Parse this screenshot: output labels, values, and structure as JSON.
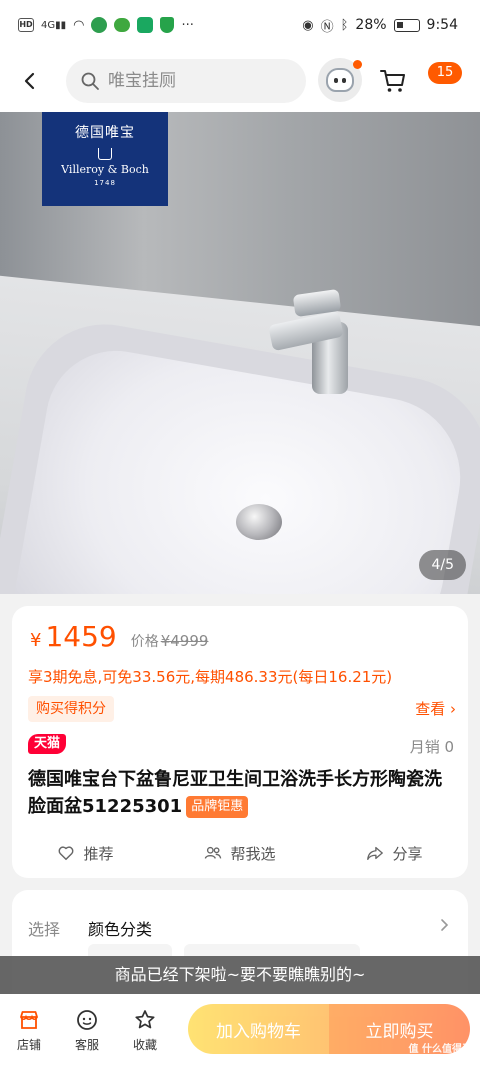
{
  "status_bar": {
    "net_label": "4G",
    "battery": "28%",
    "time": "9:54"
  },
  "header": {
    "search_placeholder": "唯宝挂厕",
    "more_badge": "15"
  },
  "gallery": {
    "brand_cn": "德国唯宝",
    "brand_en": "Villeroy & Boch",
    "brand_year": "1748",
    "counter": "4/5"
  },
  "price": {
    "currency": "¥",
    "current": "1459",
    "original_label": "价格",
    "original_value": "¥4999",
    "installment": "享3期免息,可免33.56元,每期486.33元(每日16.21元)",
    "points_tag": "购买得积分",
    "view_link": "查看 ›"
  },
  "product": {
    "store_badge": "天猫",
    "monthly_sales": "月销 0",
    "title": "德国唯宝台下盆鲁尼亚卫生间卫浴洗手长方形陶瓷洗脸面盆51225301",
    "discount_tag": "品牌钜惠"
  },
  "actions": {
    "recommend": "推荐",
    "help_choose": "帮我选",
    "share": "分享"
  },
  "selection": {
    "label": "选择",
    "value": "颜色分类"
  },
  "banner": {
    "offline_text": "商品已经下架啦~要不要瞧瞧别的~"
  },
  "bottom_bar": {
    "store": "店铺",
    "service": "客服",
    "favorite": "收藏",
    "add_cart": "加入购物车",
    "buy_now": "立即购买",
    "watermark": "值 什么值得买"
  },
  "colors": {
    "accent": "#ff5000",
    "tmall_red": "#ff0036",
    "brand_blue": "#14337a"
  }
}
